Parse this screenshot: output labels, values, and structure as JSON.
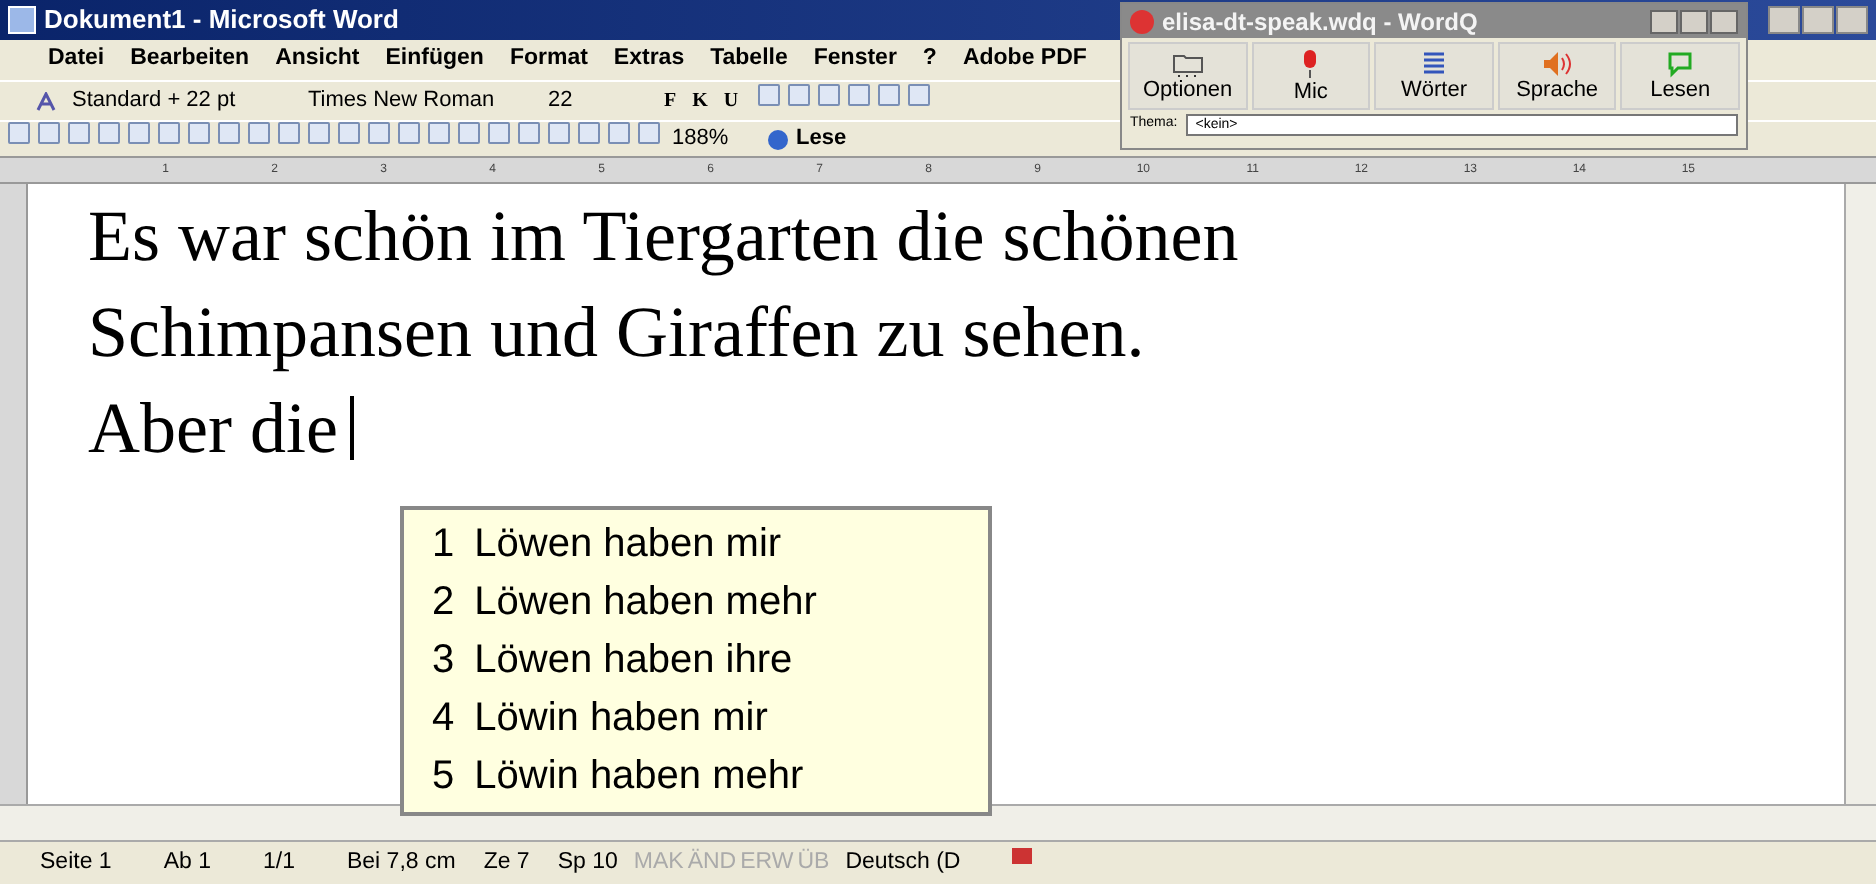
{
  "window": {
    "title": "Dokument1 - Microsoft Word"
  },
  "menu": [
    "Datei",
    "Bearbeiten",
    "Ansicht",
    "Einfügen",
    "Format",
    "Extras",
    "Tabelle",
    "Fenster",
    "?",
    "Adobe PDF"
  ],
  "format_toolbar": {
    "style": "Standard + 22 pt",
    "font": "Times New Roman",
    "size": "22",
    "text_buttons": [
      "F",
      "K",
      "U"
    ]
  },
  "standard_toolbar": {
    "zoom": "188%",
    "reading": "Lese"
  },
  "ruler": [
    "1",
    "2",
    "3",
    "4",
    "5",
    "6",
    "7",
    "8",
    "9",
    "10",
    "11",
    "12",
    "13",
    "14",
    "15"
  ],
  "document": {
    "lines": [
      "Es war schön im Tiergarten die schönen",
      "Schimpansen und Giraffen zu sehen.",
      "Aber die"
    ]
  },
  "suggestions": [
    {
      "number": "1",
      "text": "Löwen haben mir"
    },
    {
      "number": "2",
      "text": "Löwen haben mehr"
    },
    {
      "number": "3",
      "text": "Löwen haben ihre"
    },
    {
      "number": "4",
      "text": "Löwin haben mir"
    },
    {
      "number": "5",
      "text": "Löwin haben mehr"
    }
  ],
  "wordq": {
    "title": "elisa-dt-speak.wdq - WordQ",
    "buttons": [
      {
        "label": "Optionen",
        "kind": "folder"
      },
      {
        "label": "Mic",
        "kind": "mic"
      },
      {
        "label": "Wörter",
        "kind": "list"
      },
      {
        "label": "Sprache",
        "kind": "speaker"
      },
      {
        "label": "Lesen",
        "kind": "bubble"
      }
    ],
    "theme_label": "Thema:",
    "theme_value": "<kein>"
  },
  "status_bar": [
    {
      "text": "Seite 1",
      "disabled": false
    },
    {
      "text": "Ab 1",
      "disabled": false
    },
    {
      "text": "1/1",
      "disabled": false
    },
    {
      "text": "Bei 7,8 cm",
      "disabled": false
    },
    {
      "text": "Ze 7",
      "disabled": false
    },
    {
      "text": "Sp 10",
      "disabled": false
    },
    {
      "text": "MAK",
      "disabled": true
    },
    {
      "text": "ÄND",
      "disabled": true
    },
    {
      "text": "ERW",
      "disabled": true
    },
    {
      "text": "ÜB",
      "disabled": true
    },
    {
      "text": "Deutsch (D",
      "disabled": false
    }
  ]
}
